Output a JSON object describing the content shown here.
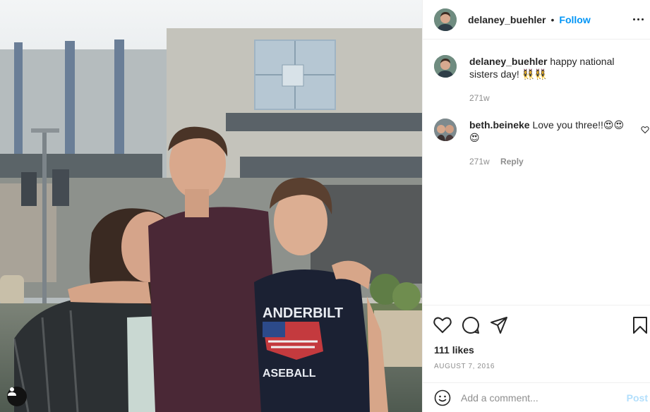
{
  "post": {
    "author": "delaney_buehler",
    "separator": "•",
    "follow_label": "Follow",
    "more_icon": "more-options-icon"
  },
  "comments": [
    {
      "username": "delaney_buehler",
      "text": "happy national sisters day! 👯‍♀️👯‍♀️",
      "time": "271w",
      "reply_label": ""
    },
    {
      "username": "beth.beineke",
      "text": "Love you three!!😍😍😍",
      "time": "271w",
      "reply_label": "Reply"
    }
  ],
  "actions": {
    "like_icon": "heart-icon",
    "comment_icon": "comment-icon",
    "share_icon": "share-icon",
    "save_icon": "bookmark-icon"
  },
  "likes": "111 likes",
  "date": "AUGUST 7, 2016",
  "add_comment": {
    "placeholder": "Add a comment...",
    "post_label": "Post",
    "emoji_icon": "emoji-icon"
  },
  "colors": {
    "accent": "#0095f6",
    "post_disabled": "#b2dffc",
    "muted": "#8e8e8e"
  }
}
